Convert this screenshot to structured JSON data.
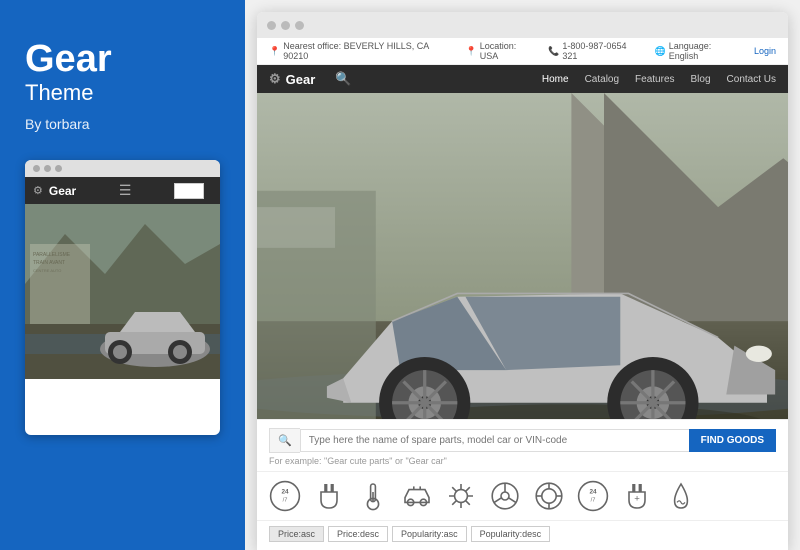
{
  "left": {
    "title": "Gear",
    "subtitle": "Theme",
    "author": "By torbara"
  },
  "mini_browser": {
    "nav_title": "Gear",
    "dots": [
      "dot1",
      "dot2",
      "dot3"
    ]
  },
  "big_browser": {
    "dots": [
      "dot1",
      "dot2",
      "dot3"
    ],
    "utility_bar": {
      "office": "Nearest office: BEVERLY HILLS, CA 90210",
      "location": "Location: USA",
      "phone": "1-800-987-0654 321",
      "language": "Language: English",
      "login": "Login"
    },
    "nav": {
      "brand": "Gear",
      "links": [
        "Home",
        "Catalog",
        "Features",
        "Blog",
        "Contact Us"
      ]
    },
    "search": {
      "placeholder": "Type here the name of spare parts, model car or VIN-code",
      "button": "FIND GOODS",
      "example": "For example: \"Gear cute parts\" or \"Gear car\""
    },
    "filter_tags": [
      "Price:asc",
      "Price:desc",
      "Popularity:asc",
      "Popularity:desc"
    ]
  }
}
